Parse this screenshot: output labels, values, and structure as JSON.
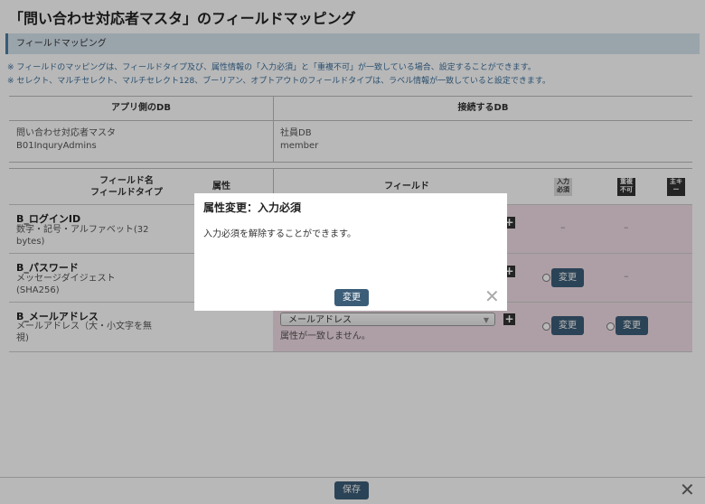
{
  "page": {
    "title": "「問い合わせ対応者マスタ」のフィールドマッピング",
    "section_label": "フィールドマッピング",
    "notes": [
      "※ フィールドのマッピングは、フィールドタイプ及び、属性情報の「入力必須」と「重複不可」が一致している場合、設定することができます。",
      "※ セレクト、マルチセレクト、マルチセレクト128、ブーリアン、オプトアウトのフィールドタイプは、ラベル情報が一致していると設定できます。"
    ]
  },
  "db_table": {
    "headers": [
      "アプリ側のDB",
      "接続するDB"
    ],
    "app_db": {
      "name": "問い合わせ対応者マスタ",
      "code": "B01InquryAdmins"
    },
    "connect_db": {
      "name": "社員DB",
      "code": "member"
    }
  },
  "mapping": {
    "headers": {
      "field_name": "フィールド名",
      "field_type": "フィールドタイプ",
      "attribute": "属性",
      "field": "フィールド",
      "required_icon": "入力必須",
      "unique_icon": "重複不可",
      "key_icon": "主キー"
    },
    "rows": [
      {
        "name": "B_ログインID",
        "type": "数字・記号・アルファベット(32 bytes)",
        "required": "–",
        "unique": "–"
      },
      {
        "name": "B_パスワード",
        "type": "メッセージダイジェスト (SHA256)",
        "required_button": "変更",
        "unique": "–"
      },
      {
        "name": "B_メールアドレス",
        "type": "メールアドレス（大・小文字を無視)",
        "select_value": "メールアドレス",
        "attr_message": "属性が一致しません。",
        "required_button": "変更",
        "unique_button": "変更"
      }
    ]
  },
  "footer": {
    "save_label": "保存",
    "close_glyph": "✕"
  },
  "modal": {
    "title": "属性変更：入力必須",
    "message": "入力必須を解除することができます。",
    "button_label": "変更",
    "close_glyph": "✕"
  }
}
